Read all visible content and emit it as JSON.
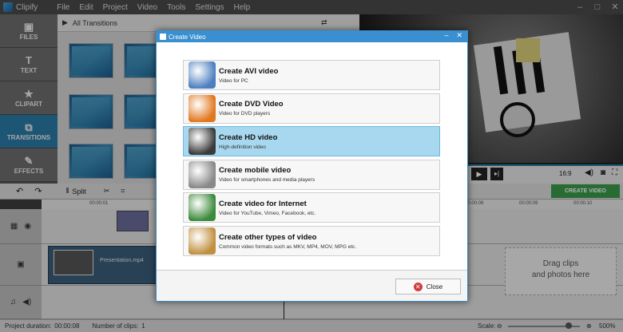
{
  "app": {
    "title": "Clipify"
  },
  "menu": [
    "File",
    "Edit",
    "Project",
    "Video",
    "Tools",
    "Settings",
    "Help"
  ],
  "sidebar": {
    "items": [
      {
        "label": "FILES",
        "icon": "image-icon"
      },
      {
        "label": "TEXT",
        "icon": "text-icon"
      },
      {
        "label": "CLIPART",
        "icon": "star-icon"
      },
      {
        "label": "TRANSITIONS",
        "icon": "transitions-icon"
      },
      {
        "label": "EFFECTS",
        "icon": "wand-icon"
      }
    ]
  },
  "transitions": {
    "header": "All Transitions"
  },
  "preview": {
    "aspect": "16:9"
  },
  "toolbar": {
    "split_label": "Split",
    "create_video_label": "CREATE VIDEO"
  },
  "ruler": {
    "ticks": [
      "00:00:01",
      "00:00:08",
      "00:00:09",
      "00:00:10"
    ]
  },
  "timeline": {
    "clip_label": "Presentation.mp4",
    "drag_text_1": "Drag clips",
    "drag_text_2": "and photos here"
  },
  "status": {
    "duration_label": "Project duration:",
    "duration": "00:00:08",
    "clips_label": "Number of clips:",
    "clips": "1",
    "scale_label": "Scale:",
    "zoom": "500%"
  },
  "dialog": {
    "title": "Create Video",
    "options": [
      {
        "title": "Create AVI video",
        "desc": "Video for PC",
        "icon": "avi-icon",
        "color": "#4d7fc0"
      },
      {
        "title": "Create DVD Video",
        "desc": "Video for DVD players",
        "icon": "dvd-icon",
        "color": "#e07820"
      },
      {
        "title": "Create HD video",
        "desc": "High-definition video",
        "icon": "hd-monitor-icon",
        "color": "#3a3a3a"
      },
      {
        "title": "Create mobile video",
        "desc": "Video for smartphones and media players",
        "icon": "mobile-icon",
        "color": "#888888"
      },
      {
        "title": "Create video for Internet",
        "desc": "Video for YouTube, Vimeo, Facebook, etc.",
        "icon": "globe-icon",
        "color": "#3c8a3c"
      },
      {
        "title": "Create other types of video",
        "desc": "Common video formats such as MKV, MP4, MOV, MPG etc.",
        "icon": "film-reel-icon",
        "color": "#c09040"
      }
    ],
    "close_label": "Close",
    "selected_index": 2
  }
}
